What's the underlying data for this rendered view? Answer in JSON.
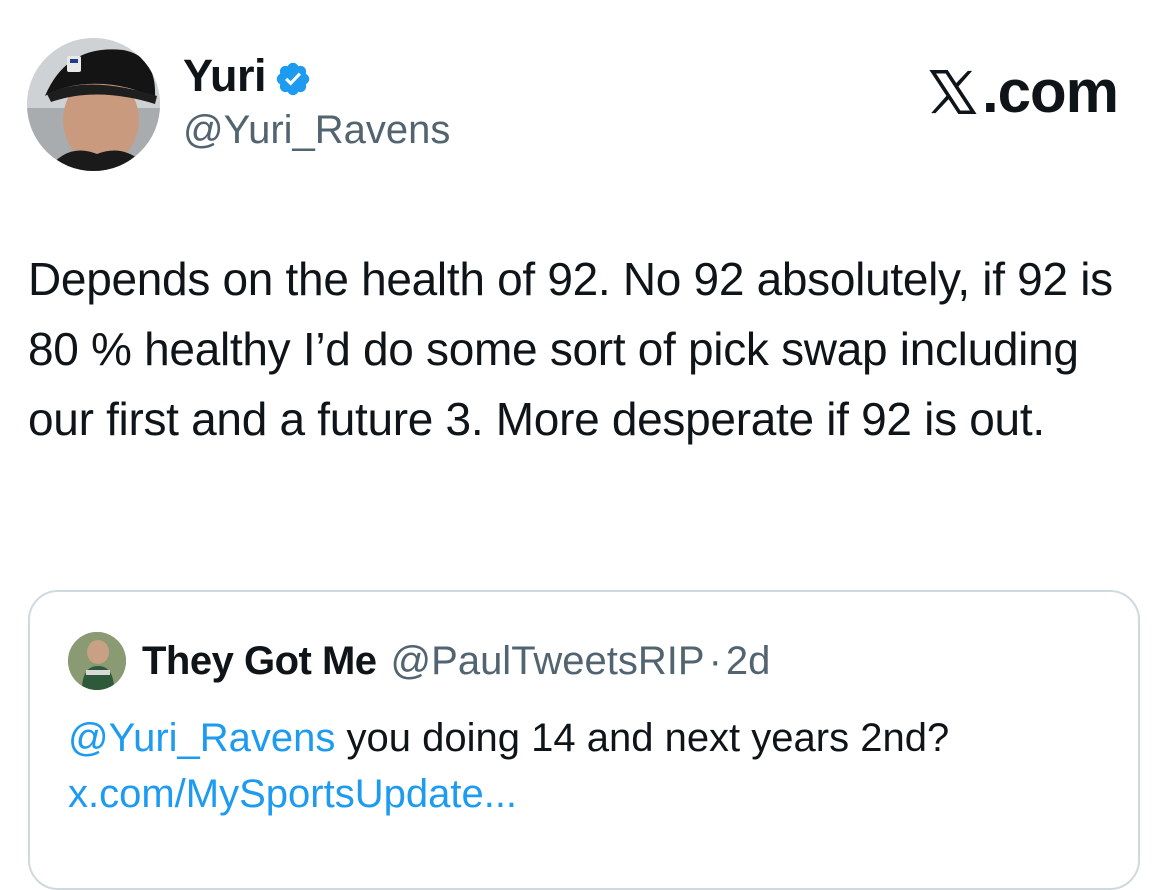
{
  "author": {
    "display_name": "Yuri",
    "handle": "@Yuri_Ravens",
    "verified_icon": "verified-badge-icon",
    "verified_color": "#1d9bf0"
  },
  "brand": {
    "label": ".com",
    "logo_icon": "x-logo-icon"
  },
  "tweet": {
    "text": "Depends on the health of 92. No 92 absolutely, if 92 is 80 % healthy I’d do some sort of pick swap including our first and a future 3. More desperate if 92 is out."
  },
  "quote": {
    "display_name": "They Got Me",
    "handle": "@PaulTweetsRIP",
    "separator": "·",
    "time": "2d",
    "mention": "@Yuri_Ravens",
    "text": " you doing 14 and next years 2nd?",
    "link": "x.com/MySportsUpdate..."
  },
  "colors": {
    "text": "#0f1419",
    "secondary": "#536471",
    "accent": "#1d9bf0",
    "border": "#cfd9de"
  }
}
